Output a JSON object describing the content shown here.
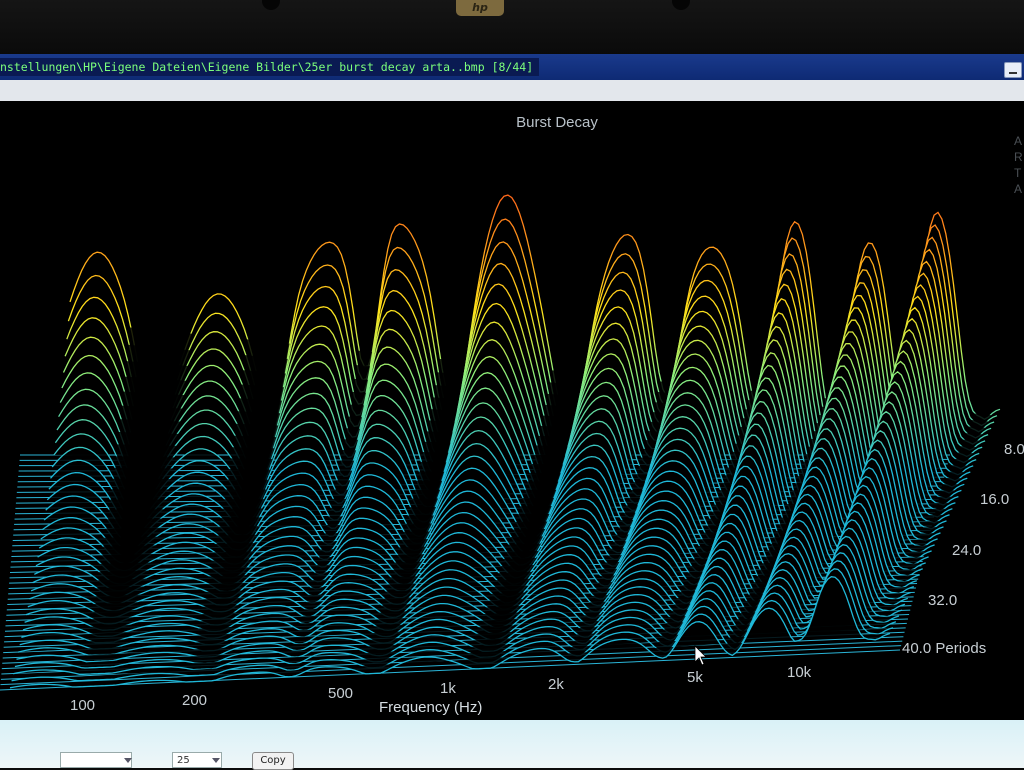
{
  "window": {
    "title": "nstellungen\\HP\\Eigene Dateien\\Eigene Bilder\\25er burst decay arta..bmp [8/44]",
    "bezel_logo": "hp"
  },
  "brand_letters": [
    "A",
    "R",
    "T",
    "A"
  ],
  "footer": {
    "field_value": "25",
    "copy_label": "Copy"
  },
  "chart_data": {
    "type": "waterfall-3d",
    "title": "Burst Decay",
    "xlabel": "Frequency (Hz)",
    "xscale": "log",
    "x_ticks": [
      "100",
      "200",
      "500",
      "1k",
      "2k",
      "5k",
      "10k"
    ],
    "x_tick_values": [
      100,
      200,
      500,
      1000,
      2000,
      5000,
      10000
    ],
    "depth_label": "Periods",
    "depth_ticks": [
      "8.0",
      "16.0",
      "24.0",
      "32.0",
      "40.0"
    ],
    "depth_tick_values": [
      8,
      16,
      24,
      32,
      40
    ],
    "colors": {
      "high": "#ff3b1a",
      "mid": "#ffe21a",
      "low": "#1fb8d8",
      "floor": "#2ab4d6"
    }
  }
}
